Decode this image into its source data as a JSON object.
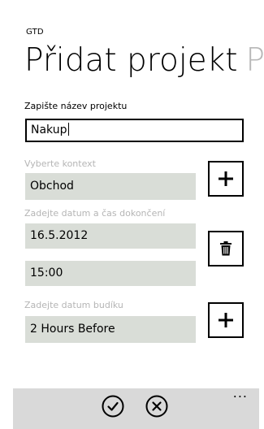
{
  "app": {
    "title": "GTD"
  },
  "header": {
    "title": "Přidat projekt",
    "next_pivot": "P"
  },
  "project_name": {
    "label": "Zapište název projektu",
    "value": "Nakup"
  },
  "context": {
    "label": "Vyberte kontext",
    "value": "Obchod"
  },
  "deadline": {
    "label": "Zadejte datum a čas dokončení",
    "date": "16.5.2012",
    "time": "15:00"
  },
  "alarm": {
    "label": "Zadejte datum budíku",
    "value": "2 Hours Before"
  },
  "buttons": {
    "add_context_icon": "plus-icon",
    "clear_deadline_icon": "trash-icon",
    "add_alarm_icon": "plus-icon"
  },
  "app_bar": {
    "confirm_icon": "check-circle-icon",
    "cancel_icon": "x-circle-icon",
    "more_label": "..."
  }
}
